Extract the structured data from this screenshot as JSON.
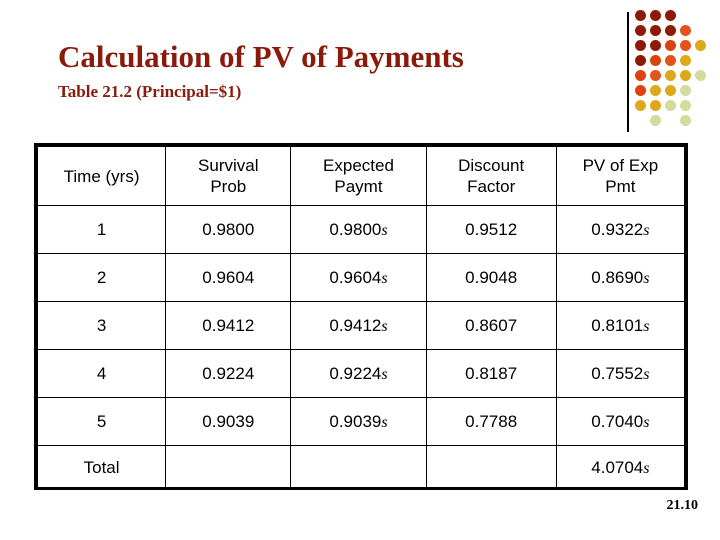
{
  "slide": {
    "title": "Calculation of PV of Payments",
    "subtitle": "Table 21.2 (Principal=$1)",
    "page_number": "21.10",
    "title_color": "#8a1a0a"
  },
  "decor": {
    "name": "dot-grid-decoration",
    "rows": 8,
    "columns": 5,
    "dots": [
      {
        "row": 0,
        "col": 0,
        "color": "#8c1a07"
      },
      {
        "row": 0,
        "col": 1,
        "color": "#8c1a07"
      },
      {
        "row": 0,
        "col": 2,
        "color": "#8c1a07"
      },
      {
        "row": 1,
        "col": 0,
        "color": "#8c1a07"
      },
      {
        "row": 1,
        "col": 1,
        "color": "#8c1a07"
      },
      {
        "row": 1,
        "col": 2,
        "color": "#8c1a07"
      },
      {
        "row": 1,
        "col": 3,
        "color": "#e2541a"
      },
      {
        "row": 2,
        "col": 0,
        "color": "#8c1a07"
      },
      {
        "row": 2,
        "col": 1,
        "color": "#8c1a07"
      },
      {
        "row": 2,
        "col": 2,
        "color": "#d8430f"
      },
      {
        "row": 2,
        "col": 3,
        "color": "#e2541a"
      },
      {
        "row": 2,
        "col": 4,
        "color": "#dda川"
      },
      {
        "row": 3,
        "col": 0,
        "color": "#8c1a07"
      },
      {
        "row": 3,
        "col": 1,
        "color": "#d8430f"
      },
      {
        "row": 3,
        "col": 2,
        "color": "#e2541a"
      },
      {
        "row": 3,
        "col": 3,
        "color": "#dda81a"
      },
      {
        "row": 4,
        "col": 0,
        "color": "#e04010"
      },
      {
        "row": 4,
        "col": 1,
        "color": "#e2541a"
      },
      {
        "row": 4,
        "col": 2,
        "color": "#dda81a"
      },
      {
        "row": 4,
        "col": 3,
        "color": "#dda81a"
      },
      {
        "row": 4,
        "col": 4,
        "color": "#d3dc9a"
      },
      {
        "row": 5,
        "col": 0,
        "color": "#e04010"
      },
      {
        "row": 5,
        "col": 1,
        "color": "#dda81a"
      },
      {
        "row": 5,
        "col": 2,
        "color": "#dda81a"
      },
      {
        "row": 5,
        "col": 3,
        "color": "#d3dc9a"
      },
      {
        "row": 6,
        "col": 0,
        "color": "#dda81a"
      },
      {
        "row": 6,
        "col": 1,
        "color": "#dda81a"
      },
      {
        "row": 6,
        "col": 2,
        "color": "#d3dc9a"
      },
      {
        "row": 6,
        "col": 3,
        "color": "#d3dc9a"
      },
      {
        "row": 7,
        "col": 1,
        "color": "#d3dc9a"
      },
      {
        "row": 7,
        "col": 3,
        "color": "#d3dc9a"
      }
    ]
  },
  "table": {
    "name": "pv-of-payments-table",
    "headers": [
      "Time (yrs)",
      "Survival Prob",
      "Expected Paymt",
      "Discount Factor",
      "PV of Exp Pmt"
    ],
    "header_lines": [
      [
        "Time (yrs)"
      ],
      [
        "Survival",
        "Prob"
      ],
      [
        "Expected",
        "Paymt"
      ],
      [
        "Discount",
        "Factor"
      ],
      [
        "PV of Exp",
        "Pmt"
      ]
    ],
    "rows": [
      {
        "time": "1",
        "survival_prob": "0.9800",
        "expected_paymt": "0.9800",
        "expected_paymt_sym": "s",
        "discount_factor": "0.9512",
        "pv_of_exp_pmt": "0.9322",
        "pv_of_exp_pmt_sym": "s"
      },
      {
        "time": "2",
        "survival_prob": "0.9604",
        "expected_paymt": "0.9604",
        "expected_paymt_sym": "s",
        "discount_factor": "0.9048",
        "pv_of_exp_pmt": "0.8690",
        "pv_of_exp_pmt_sym": "s"
      },
      {
        "time": "3",
        "survival_prob": "0.9412",
        "expected_paymt": "0.9412",
        "expected_paymt_sym": "s",
        "discount_factor": "0.8607",
        "pv_of_exp_pmt": "0.8101",
        "pv_of_exp_pmt_sym": "s"
      },
      {
        "time": "4",
        "survival_prob": "0.9224",
        "expected_paymt": "0.9224",
        "expected_paymt_sym": "s",
        "discount_factor": "0.8187",
        "pv_of_exp_pmt": "0.7552",
        "pv_of_exp_pmt_sym": "s"
      },
      {
        "time": "5",
        "survival_prob": "0.9039",
        "expected_paymt": "0.9039",
        "expected_paymt_sym": "s",
        "discount_factor": "0.7788",
        "pv_of_exp_pmt": "0.7040",
        "pv_of_exp_pmt_sym": "s"
      }
    ],
    "total_row": {
      "label": "Total",
      "survival_prob": "",
      "expected_paymt": "",
      "discount_factor": "",
      "pv_of_exp_pmt": "4.0704",
      "pv_of_exp_pmt_sym": "s"
    }
  }
}
